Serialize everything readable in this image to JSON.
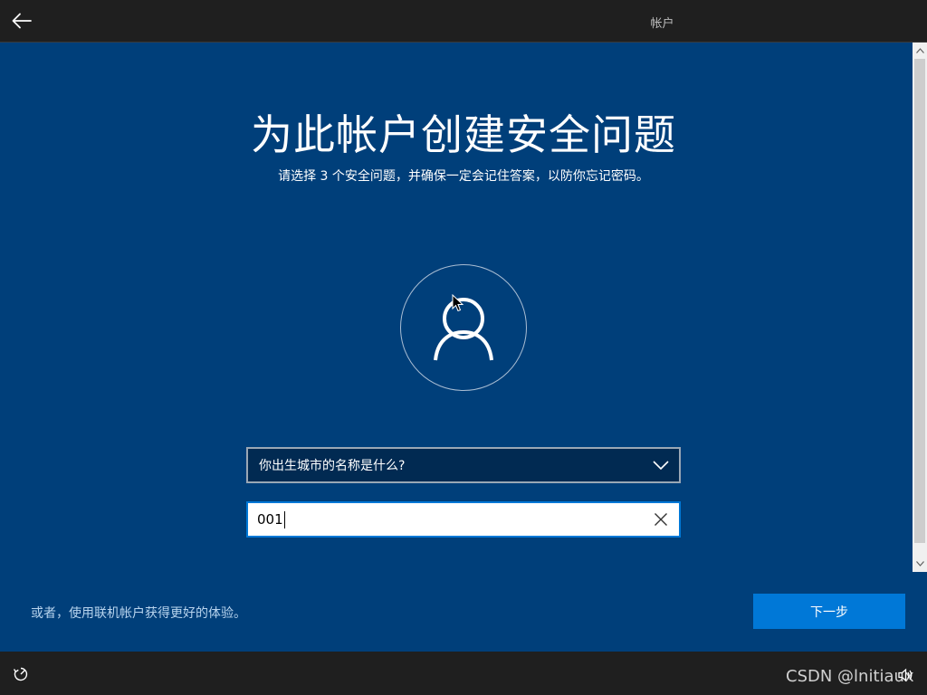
{
  "header": {
    "back_icon": "arrow-left-icon",
    "tab_label": "帐户"
  },
  "page": {
    "title": "为此帐户创建安全问题",
    "subtitle": "请选择 3 个安全问题，并确保一定会记住答案，以防你忘记密码。"
  },
  "avatar": {
    "icon": "user-icon"
  },
  "form": {
    "question_selected": "你出生城市的名称是什么?",
    "answer_value": "001"
  },
  "footer": {
    "online_account_link": "或者，使用联机帐户获得更好的体验。",
    "next_button": "下一步"
  },
  "bottombar": {
    "accessibility_icon": "ease-of-access-icon",
    "volume_icon": "volume-icon",
    "watermark": "CSDN @lnitiaux"
  },
  "colors": {
    "main_bg": "#003f7a",
    "bar_bg": "#1f1f1f",
    "accent": "#0078d7",
    "select_bg": "#012a52"
  }
}
